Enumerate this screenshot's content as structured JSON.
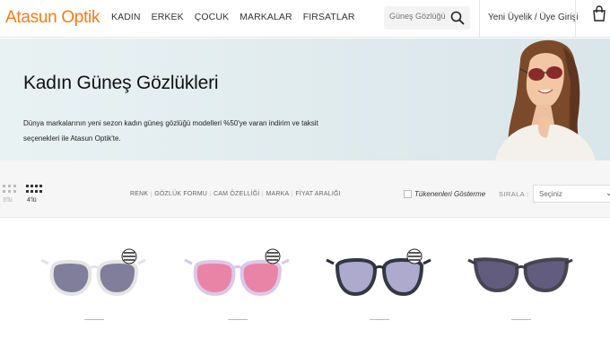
{
  "header": {
    "logo": "Atasun Optik",
    "nav": [
      "KADIN",
      "ERKEK",
      "ÇOCUK",
      "MARKALAR",
      "FIRSATLAR"
    ],
    "search_placeholder": "Güneş Gözlüğü",
    "login": "Yeni Üyelik / Üye Girişi"
  },
  "banner": {
    "title": "Kadın Güneş Gözlükleri",
    "text": "Dünya markalarının yeni sezon kadın güneş gözlüğü modelleri %50'ye varan indirim ve taksit seçenekleri ile Atasun Optik'te."
  },
  "filterbar": {
    "view_3": "3'lü",
    "view_4": "4'lü",
    "filters": [
      "RENK",
      "GÖZLÜK FORMU",
      "CAM ÖZELLİĞİ",
      "MARKA",
      "FİYAT ARALIĞI"
    ],
    "soldout_label": "Tükenenleri Gösterme",
    "sort_label": "SIRALA :",
    "sort_value": "Seçiniz"
  },
  "products": [
    {
      "frame": "#e3e3e3",
      "lens": "#7b7896",
      "badge": true
    },
    {
      "frame": "#d9c6e8",
      "lens": "#e97ea3",
      "badge": true
    },
    {
      "frame": "#2a2d3a",
      "lens": "#a9a6cc",
      "badge": true
    },
    {
      "frame": "#3e3c48",
      "lens": "#5a5478",
      "badge": false
    }
  ],
  "colors": {
    "accent": "#f07d1a"
  }
}
